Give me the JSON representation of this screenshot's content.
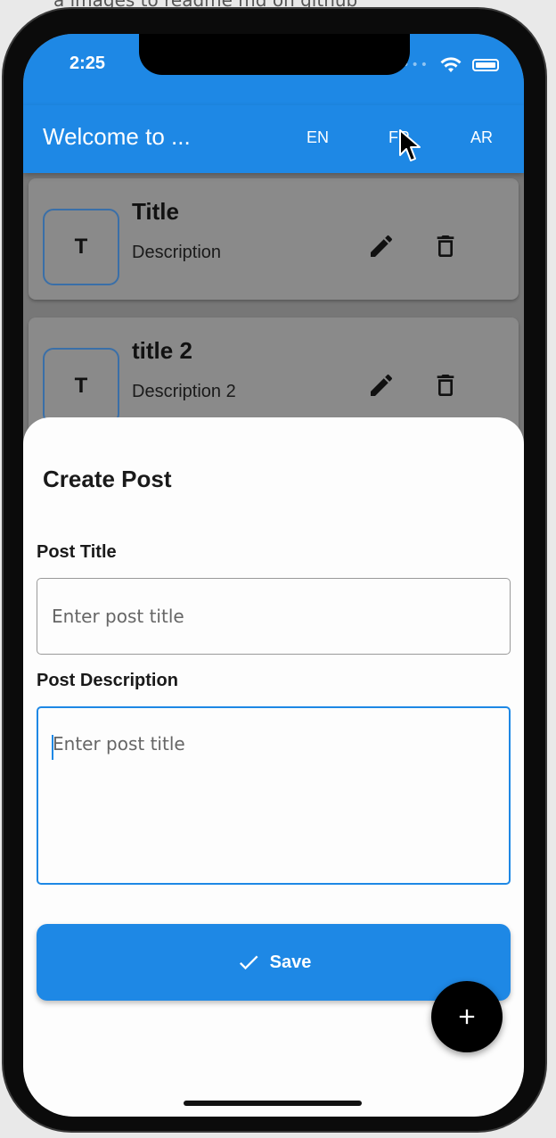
{
  "status_bar": {
    "time": "2:25",
    "signal_icon": "dots-icon",
    "wifi_icon": "wifi-icon",
    "battery_icon": "battery-icon"
  },
  "app_bar": {
    "title": "Welcome to ...",
    "languages": [
      "EN",
      "FR",
      "AR"
    ]
  },
  "posts": [
    {
      "avatar": "T",
      "title": "Title",
      "description": "Description"
    },
    {
      "avatar": "T",
      "title": "title 2",
      "description": "Description 2"
    }
  ],
  "sheet": {
    "title": "Create Post",
    "title_label": "Post Title",
    "title_placeholder": "Enter post title",
    "description_label": "Post Description",
    "description_placeholder": "Enter post title",
    "save_label": "Save"
  },
  "colors": {
    "primary": "#1e88e5",
    "fab": "#000000"
  }
}
